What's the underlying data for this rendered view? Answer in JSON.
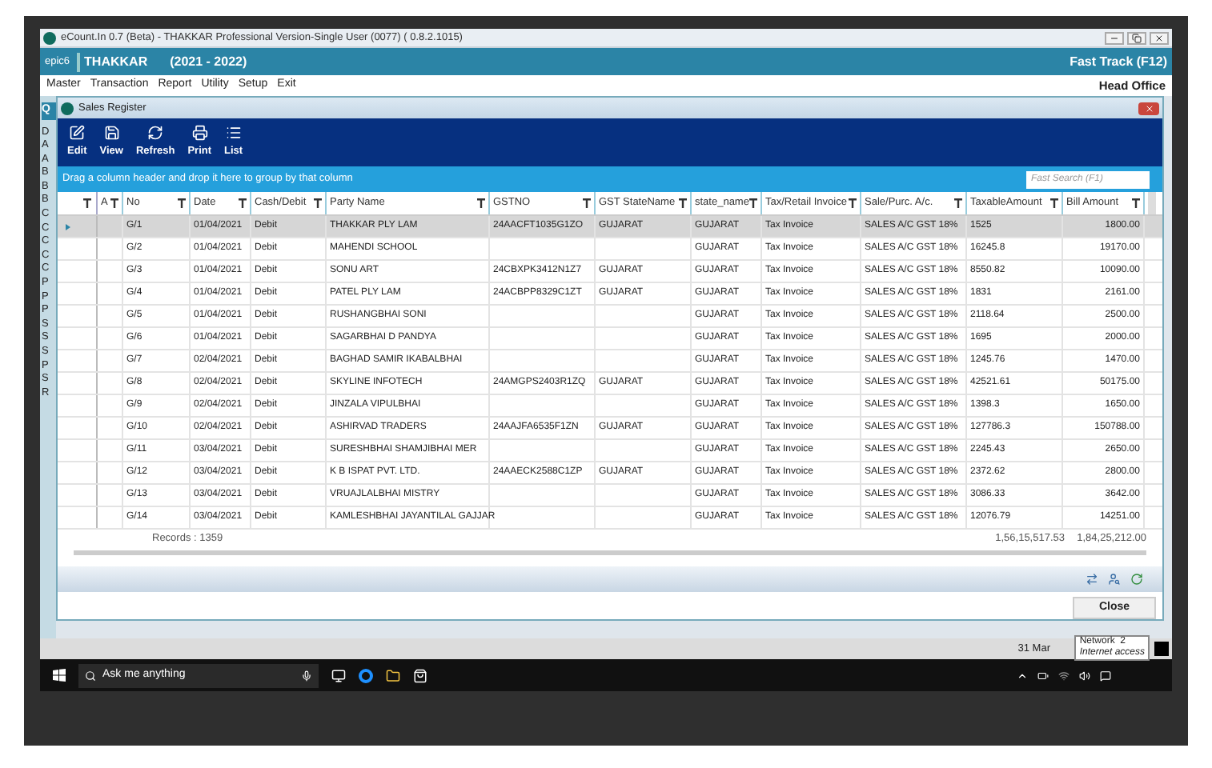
{
  "window": {
    "title": "eCount.In 0.7 (Beta) - THAKKAR Professional Version-Single User (0077) ( 0.8.2.1015)"
  },
  "app_header": {
    "code": "epic6",
    "company": "THAKKAR",
    "year": "(2021 - 2022)",
    "fast_track": "Fast Track (F12)"
  },
  "menu": {
    "items": [
      "Master",
      "Transaction",
      "Report",
      "Utility",
      "Setup",
      "Exit"
    ],
    "branch": "Head Office"
  },
  "sidebar": {
    "header": "Q",
    "letters": [
      "D",
      "A",
      "A",
      "B",
      "B",
      "B",
      "C",
      "C",
      "C",
      "C",
      "C",
      "P",
      "P",
      "P",
      "S",
      "S",
      "S",
      "P",
      "S",
      "R"
    ]
  },
  "sales_register": {
    "title": "Sales Register",
    "toolbar": [
      {
        "label": "Edit",
        "kind": "edit"
      },
      {
        "label": "View",
        "kind": "view"
      },
      {
        "label": "Refresh",
        "kind": "refresh"
      },
      {
        "label": "Print",
        "kind": "print"
      },
      {
        "label": "List",
        "kind": "list"
      }
    ],
    "group_hint": "Drag a column header and drop it here to group by that column",
    "fast_search": {
      "placeholder": "Fast Search (F1)"
    },
    "columns": [
      "A",
      "No",
      "Date",
      "Cash/Debit",
      "Party Name",
      "GSTNO",
      "GST StateName",
      "state_name",
      "Tax/Retail Invoice",
      "Sale/Purc. A/c.",
      "TaxableAmount",
      "Bill Amount"
    ],
    "rows": [
      {
        "selected": true,
        "no": "G/1",
        "date": "01/04/2021",
        "cash_debit": "Debit",
        "party": "THAKKAR PLY LAM",
        "gstno": "24AACFT1035G1ZO",
        "gst_state": "GUJARAT",
        "state": "GUJARAT",
        "invoice": "Tax Invoice",
        "account": "SALES A/C GST 18%",
        "taxable": "1525",
        "bill": "1800.00"
      },
      {
        "selected": false,
        "no": "G/2",
        "date": "01/04/2021",
        "cash_debit": "Debit",
        "party": "MAHENDI SCHOOL",
        "state": "GUJARAT",
        "invoice": "Tax Invoice",
        "account": "SALES A/C GST 18%",
        "taxable": "16245.8",
        "bill": "19170.00"
      },
      {
        "selected": false,
        "no": "G/3",
        "date": "01/04/2021",
        "cash_debit": "Debit",
        "party": "SONU ART",
        "gstno": "24CBXPK3412N1Z7",
        "gst_state": "GUJARAT",
        "state": "GUJARAT",
        "invoice": "Tax Invoice",
        "account": "SALES A/C GST 18%",
        "taxable": "8550.82",
        "bill": "10090.00"
      },
      {
        "selected": false,
        "no": "G/4",
        "date": "01/04/2021",
        "cash_debit": "Debit",
        "party": "PATEL PLY LAM",
        "gstno": "24ACBPP8329C1ZT",
        "gst_state": "GUJARAT",
        "state": "GUJARAT",
        "invoice": "Tax Invoice",
        "account": "SALES A/C GST 18%",
        "taxable": "1831",
        "bill": "2161.00"
      },
      {
        "selected": false,
        "no": "G/5",
        "date": "01/04/2021",
        "cash_debit": "Debit",
        "party": "RUSHANGBHAI SONI",
        "state": "GUJARAT",
        "invoice": "Tax Invoice",
        "account": "SALES A/C GST 18%",
        "taxable": "2118.64",
        "bill": "2500.00"
      },
      {
        "selected": false,
        "no": "G/6",
        "date": "01/04/2021",
        "cash_debit": "Debit",
        "party": "SAGARBHAI D PANDYA",
        "state": "GUJARAT",
        "invoice": "Tax Invoice",
        "account": "SALES A/C GST 18%",
        "taxable": "1695",
        "bill": "2000.00"
      },
      {
        "selected": false,
        "no": "G/7",
        "date": "02/04/2021",
        "cash_debit": "Debit",
        "party": "BAGHAD SAMIR IKABALBHAI",
        "state": "GUJARAT",
        "invoice": "Tax Invoice",
        "account": "SALES A/C GST 18%",
        "taxable": "1245.76",
        "bill": "1470.00"
      },
      {
        "selected": false,
        "no": "G/8",
        "date": "02/04/2021",
        "cash_debit": "Debit",
        "party": "SKYLINE INFOTECH",
        "gstno": "24AMGPS2403R1ZQ",
        "gst_state": "GUJARAT",
        "state": "GUJARAT",
        "invoice": "Tax Invoice",
        "account": "SALES A/C GST 18%",
        "taxable": "42521.61",
        "bill": "50175.00"
      },
      {
        "selected": false,
        "no": "G/9",
        "date": "02/04/2021",
        "cash_debit": "Debit",
        "party": "JINZALA VIPULBHAI",
        "state": "GUJARAT",
        "invoice": "Tax Invoice",
        "account": "SALES A/C GST 18%",
        "taxable": "1398.3",
        "bill": "1650.00"
      },
      {
        "selected": false,
        "no": "G/10",
        "date": "02/04/2021",
        "cash_debit": "Debit",
        "party": "ASHIRVAD TRADERS",
        "gstno": "24AAJFA6535F1ZN",
        "gst_state": "GUJARAT",
        "state": "GUJARAT",
        "invoice": "Tax Invoice",
        "account": "SALES A/C GST 18%",
        "taxable": "127786.3",
        "bill": "150788.00"
      },
      {
        "selected": false,
        "no": "G/11",
        "date": "03/04/2021",
        "cash_debit": "Debit",
        "party": "SURESHBHAI SHAMJIBHAI MER",
        "state": "GUJARAT",
        "invoice": "Tax Invoice",
        "account": "SALES A/C GST 18%",
        "taxable": "2245.43",
        "bill": "2650.00"
      },
      {
        "selected": false,
        "no": "G/12",
        "date": "03/04/2021",
        "cash_debit": "Debit",
        "party": "K B ISPAT PVT. LTD.",
        "gstno": "24AAECK2588C1ZP",
        "gst_state": "GUJARAT",
        "state": "GUJARAT",
        "invoice": "Tax Invoice",
        "account": "SALES A/C GST 18%",
        "taxable": "2372.62",
        "bill": "2800.00"
      },
      {
        "selected": false,
        "no": "G/13",
        "date": "03/04/2021",
        "cash_debit": "Debit",
        "party": "VRUAJLALBHAI MISTRY",
        "state": "GUJARAT",
        "invoice": "Tax Invoice",
        "account": "SALES A/C GST 18%",
        "taxable": "3086.33",
        "bill": "3642.00"
      },
      {
        "selected": false,
        "no": "G/14",
        "date": "03/04/2021",
        "cash_debit": "Debit",
        "party": "KAMLESHBHAI JAYANTILAL GAJJAR",
        "state": "GUJARAT",
        "invoice": "Tax Invoice",
        "account": "SALES A/C GST 18%",
        "taxable": "12076.79",
        "bill": "14251.00"
      }
    ],
    "records": "Records : 1359",
    "total_taxable": "1,56,15,517.53",
    "total_bill": "1,84,25,212.00",
    "close": "Close"
  },
  "status_bar": {
    "date": "31 Mar",
    "tooltip": {
      "title": "Network  2",
      "subtitle": "Internet access"
    }
  },
  "taskbar": {
    "search_placeholder": "Ask me anything"
  }
}
